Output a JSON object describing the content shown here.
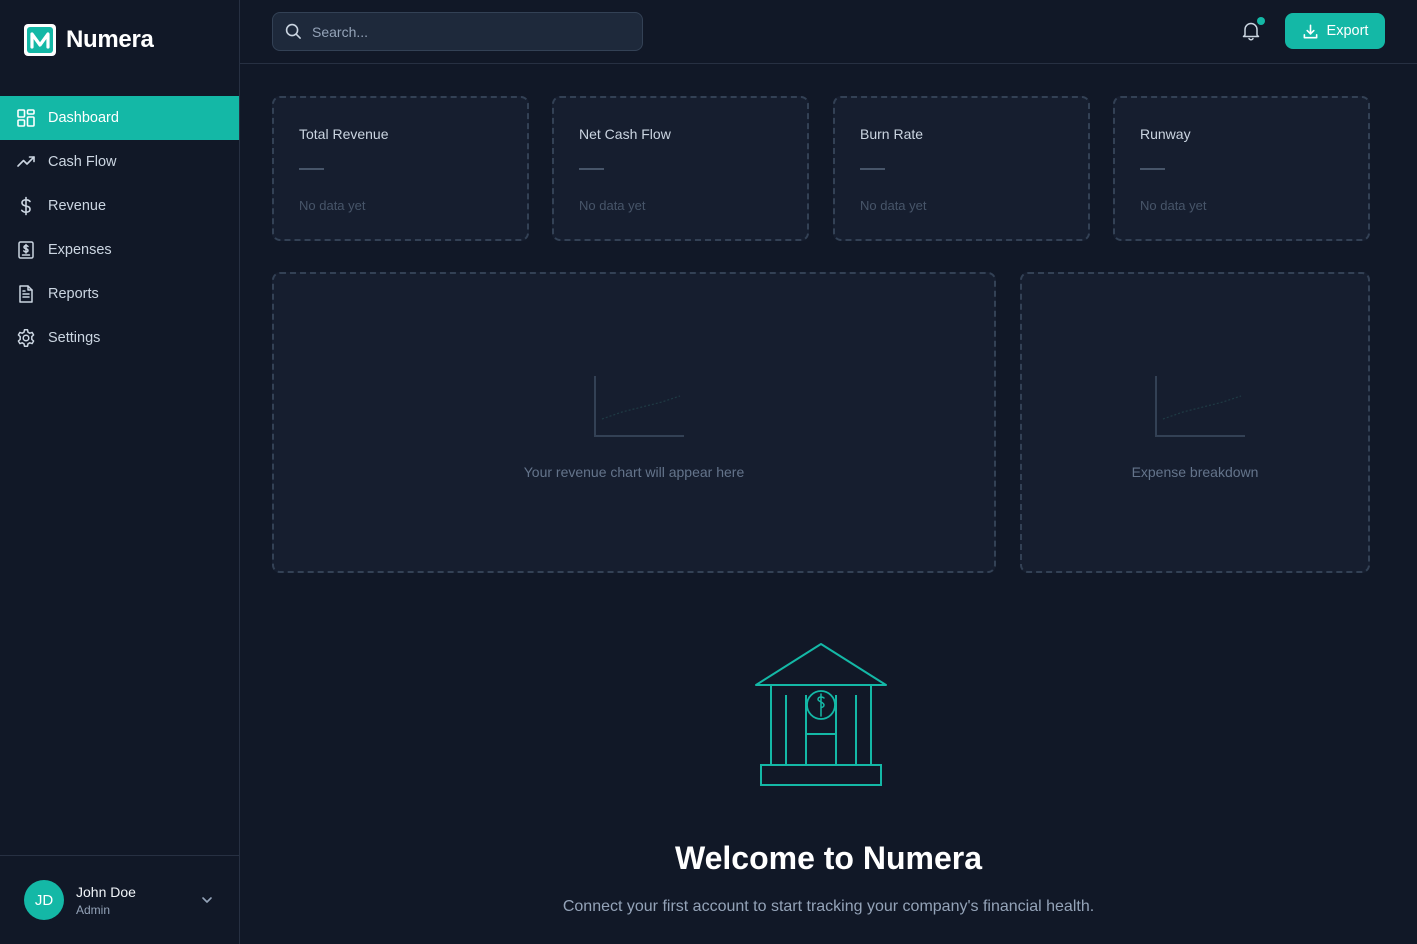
{
  "brand": {
    "name": "Numera"
  },
  "sidebar": {
    "items": [
      {
        "label": "Dashboard",
        "icon": "dashboard-icon",
        "active": true
      },
      {
        "label": "Cash Flow",
        "icon": "trending-up-icon",
        "active": false
      },
      {
        "label": "Revenue",
        "icon": "dollar-icon",
        "active": false
      },
      {
        "label": "Expenses",
        "icon": "receipt-icon",
        "active": false
      },
      {
        "label": "Reports",
        "icon": "document-icon",
        "active": false
      },
      {
        "label": "Settings",
        "icon": "gear-icon",
        "active": false
      }
    ]
  },
  "user": {
    "initials": "JD",
    "name": "John Doe",
    "role": "Admin"
  },
  "header": {
    "search_placeholder": "Search...",
    "export_label": "Export",
    "notification_indicator": true
  },
  "stats": [
    {
      "title": "Total Revenue",
      "value": "—",
      "subtitle": "No data yet"
    },
    {
      "title": "Net Cash Flow",
      "value": "—",
      "subtitle": "No data yet"
    },
    {
      "title": "Burn Rate",
      "value": "—",
      "subtitle": "No data yet"
    },
    {
      "title": "Runway",
      "value": "—",
      "subtitle": "No data yet"
    }
  ],
  "panels": {
    "revenue_chart": {
      "placeholder": "Your revenue chart will appear here"
    },
    "expense_chart": {
      "placeholder": "Expense breakdown"
    }
  },
  "welcome": {
    "title": "Welcome to Numera",
    "subtitle": "Connect your first account to start tracking your company's financial health."
  },
  "colors": {
    "background": "#111827",
    "card": "#161e2f",
    "accent": "#14b8a6",
    "border": "#334155"
  }
}
